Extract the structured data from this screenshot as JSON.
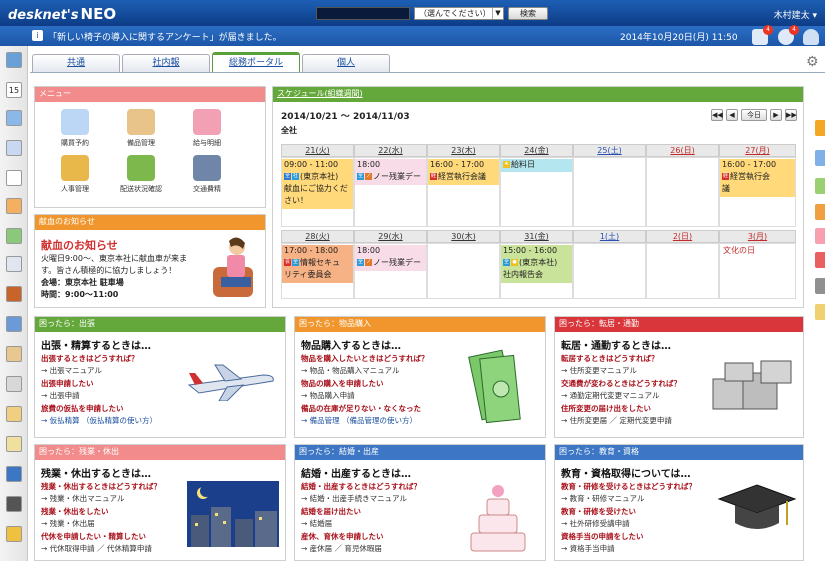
{
  "header": {
    "logo": "desknet's",
    "logo_neo": "NEO",
    "search_placeholder": "",
    "search_select": "（選んでください）",
    "search_button": "検索",
    "user": "木村建太 ▾",
    "notice_text": "「新しい椅子の導入に関するアンケート」が届きました。",
    "datetime": "2014年10月20日(月) 11:50",
    "badge1": "4",
    "badge2": "4"
  },
  "tabs": [
    {
      "label": "共通"
    },
    {
      "label": "社内報"
    },
    {
      "label": "総務ポータル"
    },
    {
      "label": "個人"
    }
  ],
  "menu": {
    "title": "メニュー",
    "items": [
      {
        "label": "購買予約",
        "icon": "cart-icon"
      },
      {
        "label": "備品管理",
        "icon": "box-icon"
      },
      {
        "label": "給与明細",
        "icon": "yen-bag-icon"
      },
      {
        "label": "人事管理",
        "icon": "people-icon"
      },
      {
        "label": "配送状況確認",
        "icon": "truck-icon"
      },
      {
        "label": "交通費精",
        "icon": "car-icon"
      }
    ]
  },
  "blood": {
    "header": "献血のお知らせ",
    "title": "献血のお知らせ",
    "line1": "火曜日9:00～、東京本社に献血車が来ま",
    "line2": "す。皆さん積極的に協力しましょう！",
    "line3": "会場：東京本社 駐車場",
    "line4": "時間：9:00～11:00"
  },
  "schedule": {
    "header": "スケジュール(組織週間)",
    "range": "2014/10/21 ～ 2014/11/03",
    "group": "全社",
    "today": "今日",
    "week1": [
      "21(火)",
      "22(水)",
      "23(木)",
      "24(金)",
      "25(土)",
      "26(日)",
      "27(月)"
    ],
    "week2": [
      "28(火)",
      "29(水)",
      "30(木)",
      "31(金)",
      "1(土)",
      "2(日)",
      "3(月)"
    ],
    "ev1a_time": "09:00 - 11:00",
    "ev1a_text": "(東京本社)",
    "ev1a_text2": "献血にご協力ください！",
    "ev1b_time": "18:00",
    "ev1b_text": "ノー残業デー",
    "ev1c_time": "16:00 - 17:00",
    "ev1c_text": "経営執行会議",
    "ev1d_text": "給料日",
    "ev1e_time": "16:00 - 17:00",
    "ev1e_text": "経営執行会",
    "ev1e_text2": "議",
    "ev2a_time": "17:00 - 18:00",
    "ev2a_text": "情報セキュ",
    "ev2a_text2": "リティ委員会",
    "ev2b_time": "18:00",
    "ev2b_text": "ノー残業デー",
    "ev2c_time": "15:00 - 16:00",
    "ev2c_text": "(東京本社)",
    "ev2c_text2": "社内報告会",
    "holiday": "文化の日"
  },
  "panels": [
    {
      "header": "困ったら：出張",
      "title": "出張・精算するときは…",
      "lines": [
        {
          "q": "出張するときはどうすれば？"
        },
        {
          "r": "→ 出張マニュアル"
        },
        {
          "q": "出張申請したい"
        },
        {
          "r": "→ 出張申請"
        },
        {
          "q": "旅費の仮払を申請したい"
        },
        {
          "r": "→ 仮払精算 （仮払精算の使い方）"
        }
      ]
    },
    {
      "header": "困ったら：物品購入",
      "title": "物品購入するときは…",
      "lines": [
        {
          "q": "物品を購入したいときはどうすれば？"
        },
        {
          "r": "→ 物品・物品購入マニュアル"
        },
        {
          "q": "物品の購入を申請したい"
        },
        {
          "r": "→ 物品購入申請"
        },
        {
          "q": "備品の在庫が足りない・なくなった"
        },
        {
          "r": "→ 備品管理 （備品管理の使い方）"
        }
      ]
    },
    {
      "header": "困ったら：転居・通勤",
      "title": "転居・通勤するときは…",
      "lines": [
        {
          "q": "転居するときはどうすれば？"
        },
        {
          "r": "→ 住所変更マニュアル"
        },
        {
          "q": "交通費が変わるときはどうすれば？"
        },
        {
          "r": "→ 通勤定期代変更マニュアル"
        },
        {
          "q": "住所変更の届け出をしたい"
        },
        {
          "r": "→ 住所変更届 ／ 定期代変更申請"
        }
      ]
    },
    {
      "header": "困ったら：残業・休出",
      "title": "残業・休出するときは…",
      "lines": [
        {
          "q": "残業・休出するときはどうすれば？"
        },
        {
          "r": "→ 残業・休出マニュアル"
        },
        {
          "q": "残業・休出をしたい"
        },
        {
          "r": "→ 残業・休出届"
        },
        {
          "q": "代休を申請したい・精算したい"
        },
        {
          "r": "→ 代休取得申請 ／ 代休精算申請"
        }
      ]
    },
    {
      "header": "困ったら：結婚・出産",
      "title": "結婚・出産するときは…",
      "lines": [
        {
          "q": "結婚・出産するときはどうすれば？"
        },
        {
          "r": "→ 結婚・出産手続きマニュアル"
        },
        {
          "q": "結婚を届け出たい"
        },
        {
          "r": "→ 結婚届"
        },
        {
          "q": "産休、育休を申請したい"
        },
        {
          "r": "→ 産休届 ／ 育児休暇届"
        }
      ]
    },
    {
      "header": "困ったら：教育・資格",
      "title": "教育・資格取得については…",
      "lines": [
        {
          "q": "教育・研修を受けるときはどうすれば？"
        },
        {
          "r": "→ 教育・研修マニュアル"
        },
        {
          "q": "教育・研修を受けたい"
        },
        {
          "r": "→ 社外研修受講申請"
        },
        {
          "q": "資格手当の申請をしたい"
        },
        {
          "r": "→ 資格手当申請"
        }
      ]
    }
  ]
}
